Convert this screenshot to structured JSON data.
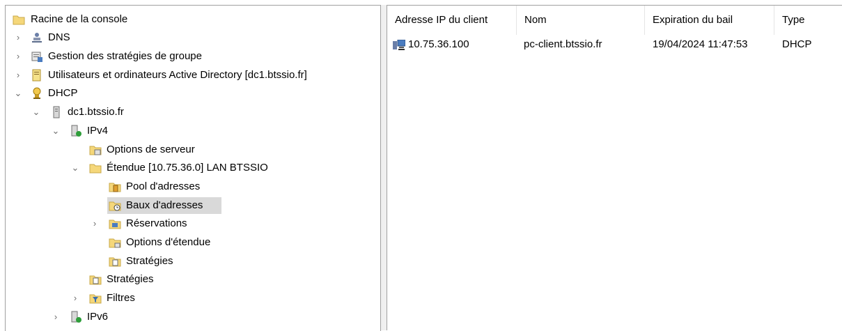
{
  "tree": {
    "root": "Racine de la console",
    "dns": "DNS",
    "gpo": "Gestion des stratégies de groupe",
    "ad": "Utilisateurs et ordinateurs Active Directory [dc1.btssio.fr]",
    "dhcp": "DHCP",
    "server": "dc1.btssio.fr",
    "ipv4": "IPv4",
    "server_options": "Options de serveur",
    "scope": "Étendue [10.75.36.0] LAN BTSSIO",
    "pool": "Pool d'adresses",
    "leases": "Baux d'adresses",
    "reservations": "Réservations",
    "scope_options": "Options d'étendue",
    "scope_policies": "Stratégies",
    "policies": "Stratégies",
    "filters": "Filtres",
    "ipv6": "IPv6"
  },
  "list": {
    "columns": [
      "Adresse IP du client",
      "Nom",
      "Expiration du bail",
      "Type"
    ],
    "rows": [
      {
        "ip": "10.75.36.100",
        "name": "pc-client.btssio.fr",
        "expiration": "19/04/2024 11:47:53",
        "type": "DHCP",
        "icon": "lease-client-icon"
      }
    ]
  },
  "colors": {
    "selection": "#d9d9d9",
    "folder": "#f5d77a",
    "border": "#a0a0a0"
  }
}
